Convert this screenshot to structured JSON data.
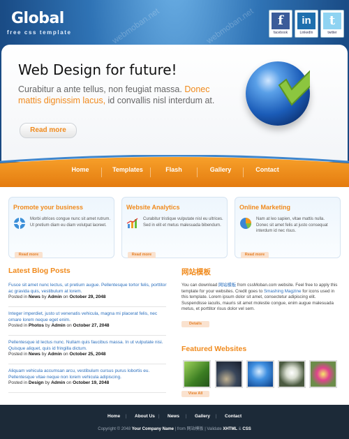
{
  "header": {
    "logo": "Global",
    "tagline": "free css template",
    "social": [
      {
        "label": "facebook",
        "glyph": "f",
        "color": "#3b5b99"
      },
      {
        "label": "LinkedIn",
        "glyph": "in",
        "color": "#1e6fae"
      },
      {
        "label": "twitter",
        "glyph": "t",
        "color": "#8fd3f2"
      }
    ]
  },
  "hero": {
    "title": "Web Design for future!",
    "text_before": "Curabitur a ante tellus, non feugiat massa. ",
    "text_highlight": "Donec mattis dignissim lacus,",
    "text_after": " id convallis nisl interdum at.",
    "button": "Read more"
  },
  "nav": [
    "Home",
    "Templates",
    "Flash",
    "Gallery",
    "Contact"
  ],
  "boxes": [
    {
      "title": "Promote your business",
      "text": "Morbi ultrices congue nunc sit amet rutrum. Ut pretium diam eu diam volutpat laoreet.",
      "more": "Read more",
      "icon": "lifebuoy-icon"
    },
    {
      "title": "Website Analytics",
      "text": "Curabitur tristique vulputate nisl eu ultrices. Sed in elit et metus malesuada bibendum.",
      "more": "Read more",
      "icon": "chart-icon"
    },
    {
      "title": "Online Marketing",
      "text": "Nam at leo sapien, vitae mattis nulla. Donec sit amet felis at justo consequat interdum id nec risus.",
      "more": "Read more",
      "icon": "pie-icon"
    }
  ],
  "blog": {
    "heading": "Latest Blog Posts",
    "posts": [
      {
        "text": "Fusce sit amet nunc lectus, ut pretium augue. Pellentesque tortor felis, porttitor ac gravida quis, vestibulum at lorem.",
        "posted_in": "Posted in ",
        "category": "News",
        "by": " by ",
        "author": "Admin",
        "on": " on ",
        "date": "October 29, 2048"
      },
      {
        "text": "Integer imperdiet, justo ut venenatis vehicula, magna mi placerat felis, nec ornare lorem neque eget enim.",
        "posted_in": "Posted in ",
        "category": "Photos",
        "by": " by ",
        "author": "Admin",
        "on": " on ",
        "date": "October 27, 2048"
      },
      {
        "text": "Pellentesque id lectus nunc. Nullam quis faucibus massa. In ut vulputate nisi. Quisque aliquet, quis id fringilla dictum.",
        "posted_in": "Posted in ",
        "category": "News",
        "by": " by ",
        "author": "Admin",
        "on": " on ",
        "date": "October 25, 2048"
      },
      {
        "text": "Aliquam vehicula accumsan arcu, vestibulum cursus purus lobortis eu. Pellentesque vitae neque non lorem vehicula adipiscing.",
        "posted_in": "Posted in ",
        "category": "Design",
        "by": " by ",
        "author": "Admin",
        "on": " on ",
        "date": "October 19, 2048"
      }
    ]
  },
  "about": {
    "heading": "网站模板",
    "p1": "You can download ",
    "link1": "网站模板",
    "p2": " from cssMoban.com website. Feel free to apply this template for your websites. Credit goes to ",
    "link2": "Smashing Magzine",
    "p3": " for icons used in this template. Lorem ipsum dolor sit amet, consectetur adipiscing elit. Suspendisse iaculis, mauris sit amet molestie congue, enim augue malesuada metus, et porttitor risus dolor vel sem.",
    "button": "Details"
  },
  "featured": {
    "heading": "Featured Websites",
    "button": "View All",
    "thumbs": [
      "#4a8f2a",
      "#2b3648",
      "#1f6fc2",
      "#6b7a60",
      "#c64a8a"
    ]
  },
  "footer": {
    "links": [
      "Home",
      "About Us",
      "News",
      "Gallery",
      "Contact"
    ],
    "copy_pre": "Copyright © 2048 ",
    "company": "Your Company Name",
    "copy_mid": " | from 网站模板 | Validate ",
    "xhtml": "XHTML",
    "amp": " & ",
    "css": "CSS"
  },
  "watermark": "webmoban.net"
}
